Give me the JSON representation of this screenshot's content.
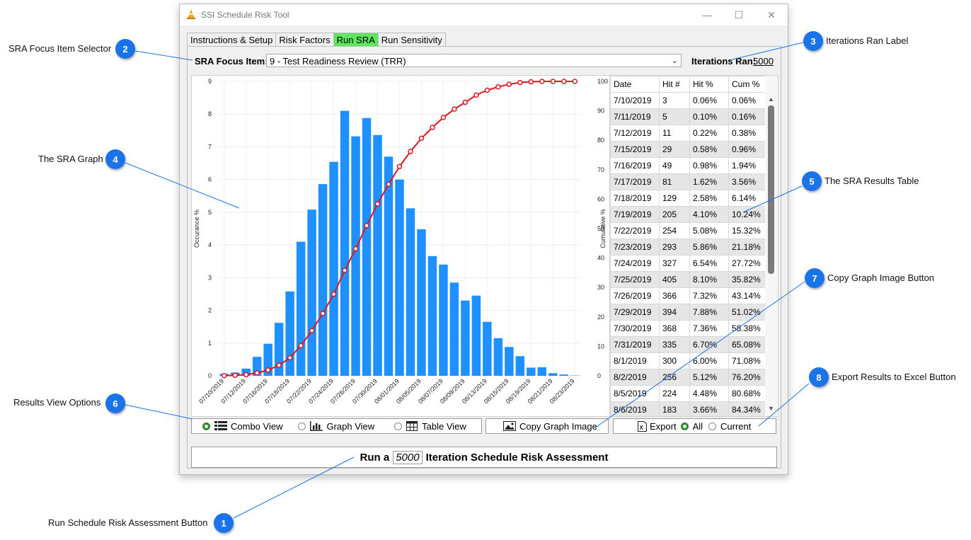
{
  "window": {
    "title": "SSI Schedule Risk Tool"
  },
  "tabs": [
    "Instructions & Setup",
    "Risk Factors",
    "Run SRA",
    "Run Sensitivity"
  ],
  "focus": {
    "label": "SRA Focus Item:",
    "value": "9 - Test Readiness Review (TRR)"
  },
  "iterations": {
    "label": "Iterations Ran:",
    "value": "5000"
  },
  "callouts": [
    {
      "num": "1",
      "text": "Run Schedule Risk Assessment Button"
    },
    {
      "num": "2",
      "text": "SRA Focus Item Selector"
    },
    {
      "num": "3",
      "text": "Iterations Ran Label"
    },
    {
      "num": "4",
      "text": "The SRA Graph"
    },
    {
      "num": "5",
      "text": "The SRA Results Table"
    },
    {
      "num": "6",
      "text": "Results View Options"
    },
    {
      "num": "7",
      "text": "Copy Graph Image Button"
    },
    {
      "num": "8",
      "text": "Export Results to Excel Button"
    }
  ],
  "table": {
    "headers": [
      "Date",
      "Hit #",
      "Hit %",
      "Cum %"
    ],
    "rows": [
      [
        "7/10/2019",
        "3",
        "0.06%",
        "0.06%"
      ],
      [
        "7/11/2019",
        "5",
        "0.10%",
        "0.16%"
      ],
      [
        "7/12/2019",
        "11",
        "0.22%",
        "0.38%"
      ],
      [
        "7/15/2019",
        "29",
        "0.58%",
        "0.96%"
      ],
      [
        "7/16/2019",
        "49",
        "0.98%",
        "1.94%"
      ],
      [
        "7/17/2019",
        "81",
        "1.62%",
        "3.56%"
      ],
      [
        "7/18/2019",
        "129",
        "2.58%",
        "6.14%"
      ],
      [
        "7/19/2019",
        "205",
        "4.10%",
        "10.24%"
      ],
      [
        "7/22/2019",
        "254",
        "5.08%",
        "15.32%"
      ],
      [
        "7/23/2019",
        "293",
        "5.86%",
        "21.18%"
      ],
      [
        "7/24/2019",
        "327",
        "6.54%",
        "27.72%"
      ],
      [
        "7/25/2019",
        "405",
        "8.10%",
        "35.82%"
      ],
      [
        "7/26/2019",
        "366",
        "7.32%",
        "43.14%"
      ],
      [
        "7/29/2019",
        "394",
        "7.88%",
        "51.02%"
      ],
      [
        "7/30/2019",
        "368",
        "7.36%",
        "58.38%"
      ],
      [
        "7/31/2019",
        "335",
        "6.70%",
        "65.08%"
      ],
      [
        "8/1/2019",
        "300",
        "6.00%",
        "71.08%"
      ],
      [
        "8/2/2019",
        "256",
        "5.12%",
        "76.20%"
      ],
      [
        "8/5/2019",
        "224",
        "4.48%",
        "80.68%"
      ],
      [
        "8/6/2019",
        "183",
        "3.66%",
        "84.34%"
      ]
    ]
  },
  "view_options": {
    "combo": "Combo View",
    "graph": "Graph View",
    "table": "Table View"
  },
  "copy_button": "Copy Graph Image",
  "export": {
    "label": "Export",
    "all": "All",
    "current": "Current"
  },
  "run_button": {
    "prefix": "Run a",
    "iterations": "5000",
    "suffix": "Iteration Schedule Risk Assessment"
  },
  "colors": {
    "bars": "#1e90ff",
    "line": "#e0141e",
    "active_tab": "#5ee65e",
    "badge": "#1a73e8"
  },
  "chart_data": {
    "type": "bar",
    "ylabel": "Occurance %",
    "y2label": "Cumulative %",
    "ylim": [
      0,
      9
    ],
    "y2lim": [
      0,
      100
    ],
    "yticks": [
      "0",
      "1",
      "2",
      "3",
      "4",
      "5",
      "6",
      "7",
      "8",
      "9"
    ],
    "y2ticks": [
      "0",
      "10",
      "20",
      "30",
      "40",
      "50",
      "60",
      "70",
      "80",
      "90",
      "100"
    ],
    "xticks": [
      "07/10/2019",
      "07/12/2019",
      "07/16/2019",
      "07/18/2019",
      "07/22/2019",
      "07/24/2019",
      "07/26/2019",
      "07/30/2019",
      "08/01/2019",
      "08/05/2019",
      "08/07/2019",
      "08/09/2019",
      "08/13/2019",
      "08/15/2019",
      "08/19/2019",
      "08/21/2019",
      "08/23/2019"
    ],
    "series": [
      {
        "type": "bar",
        "values": [
          0.06,
          0.1,
          0.22,
          0.58,
          0.98,
          1.62,
          2.58,
          4.1,
          5.08,
          5.86,
          6.54,
          8.1,
          7.32,
          7.88,
          7.36,
          6.7,
          6.0,
          5.12,
          4.48,
          3.66,
          3.4,
          2.85,
          2.3,
          2.45,
          1.65,
          1.15,
          0.88,
          0.6,
          0.25,
          0.26,
          0.08,
          0.04,
          0.01
        ]
      },
      {
        "type": "line",
        "values": [
          0.06,
          0.16,
          0.38,
          0.96,
          1.94,
          3.56,
          6.14,
          10.24,
          15.32,
          21.18,
          27.72,
          35.82,
          43.14,
          51.02,
          58.38,
          65.08,
          71.08,
          76.2,
          80.68,
          84.34,
          87.74,
          90.59,
          92.89,
          95.34,
          96.99,
          98.14,
          99.02,
          99.62,
          99.87,
          100,
          100,
          100,
          100
        ]
      }
    ]
  }
}
